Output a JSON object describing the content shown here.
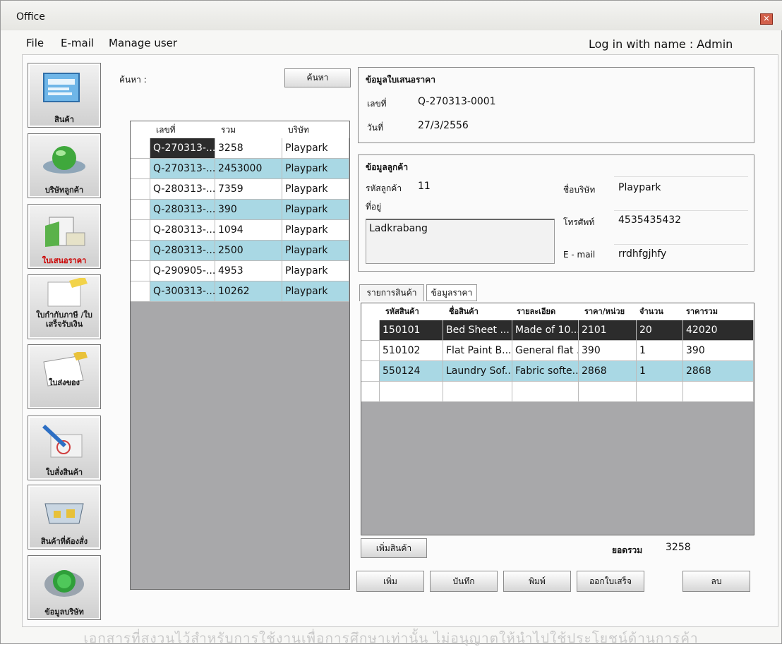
{
  "window": {
    "title": "Office",
    "close_glyph": "✕"
  },
  "menu": {
    "items": [
      "File",
      "E-mail",
      "Manage user"
    ],
    "login_text": "Log in with name : Admin"
  },
  "sidebar": {
    "items": [
      {
        "label": "สินค้า",
        "icon": "product-window-icon"
      },
      {
        "label": "บริษัทลูกค้า",
        "icon": "globe-icon"
      },
      {
        "label": "ใบเสนอราคา",
        "icon": "folder-document-icon",
        "active": true
      },
      {
        "label": "ใบกำกับภาษี /ใบเสร็จรับเงิน",
        "icon": "receipt-pencil-icon"
      },
      {
        "label": "ใบส่งของ",
        "icon": "delivery-document-icon"
      },
      {
        "label": "ใบสั่งสินค้า",
        "icon": "order-pen-icon"
      },
      {
        "label": "สินค้าที่ต้องสั่ง",
        "icon": "basket-icon"
      },
      {
        "label": "ข้อมูลบริษัท",
        "icon": "company-sphere-icon"
      }
    ]
  },
  "search": {
    "label": "ค้นหา :",
    "button": "ค้นหา"
  },
  "quote_list": {
    "columns": [
      "เลขที่",
      "รวม",
      "บริษัท"
    ],
    "rows": [
      [
        "Q-270313-...",
        "3258",
        "Playpark"
      ],
      [
        "Q-270313-...",
        "2453000",
        "Playpark"
      ],
      [
        "Q-280313-...",
        "7359",
        "Playpark"
      ],
      [
        "Q-280313-...",
        "390",
        "Playpark"
      ],
      [
        "Q-280313-...",
        "1094",
        "Playpark"
      ],
      [
        "Q-280313-...",
        "2500",
        "Playpark"
      ],
      [
        "Q-290905-...",
        "4953",
        "Playpark"
      ],
      [
        "Q-300313-...",
        "10262",
        "Playpark"
      ]
    ],
    "selected_row": 0
  },
  "quote_info": {
    "title": "ข้อมูลใบเสนอราคา",
    "number_label": "เลขที่",
    "number": "Q-270313-0001",
    "date_label": "วันที่",
    "date": "27/3/2556"
  },
  "customer": {
    "title": "ข้อมูลลูกค้า",
    "id_label": "รหัสลูกค้า",
    "id": "11",
    "address_label": "ที่อยู่",
    "address": "Ladkrabang",
    "company_label": "ชื่อบริษัท",
    "company": "Playpark",
    "phone_label": "โทรศัพท์",
    "phone": "4535435432",
    "email_label": "E - mail",
    "email": "rrdhfgjhfy"
  },
  "tabs": [
    "รายการสินค้า",
    "ข้อมูลราคา"
  ],
  "items": {
    "columns": [
      "รหัสสินค้า",
      "ชื่อสินค้า",
      "รายละเอียด",
      "ราคา/หน่วย",
      "จำนวน",
      "ราคารวม"
    ],
    "rows": [
      [
        "150101",
        "Bed Sheet ...",
        "Made of 10...",
        "2101",
        "20",
        "42020"
      ],
      [
        "510102",
        "Flat Paint B...",
        "General flat ...",
        "390",
        "1",
        "390"
      ],
      [
        "550124",
        "Laundry Sof...",
        "Fabric softe...",
        "2868",
        "1",
        "2868"
      ],
      [
        "",
        "",
        "",
        "",
        "",
        ""
      ]
    ],
    "selected_row": 0
  },
  "add_item_button": "เพิ่มสินค้า",
  "total": {
    "label": "ยอดรวม",
    "value": "3258"
  },
  "actions": {
    "add": "เพิ่ม",
    "save": "บันทึก",
    "print": "พิมพ์",
    "issue_receipt": "ออกใบเสร็จ",
    "delete": "ลบ"
  },
  "footer": "เอกสารที่สงวนไว้สำหรับการใช้งานเพื่อการศึกษาเท่านั้น ไม่อนุญาตให้นำไปใช้ประโยชน์ด้านการค้า",
  "colors": {
    "row_blue": "#a9d8e4",
    "row_selected": "#2c2c2c",
    "grid_bg": "#a8a8aa"
  }
}
